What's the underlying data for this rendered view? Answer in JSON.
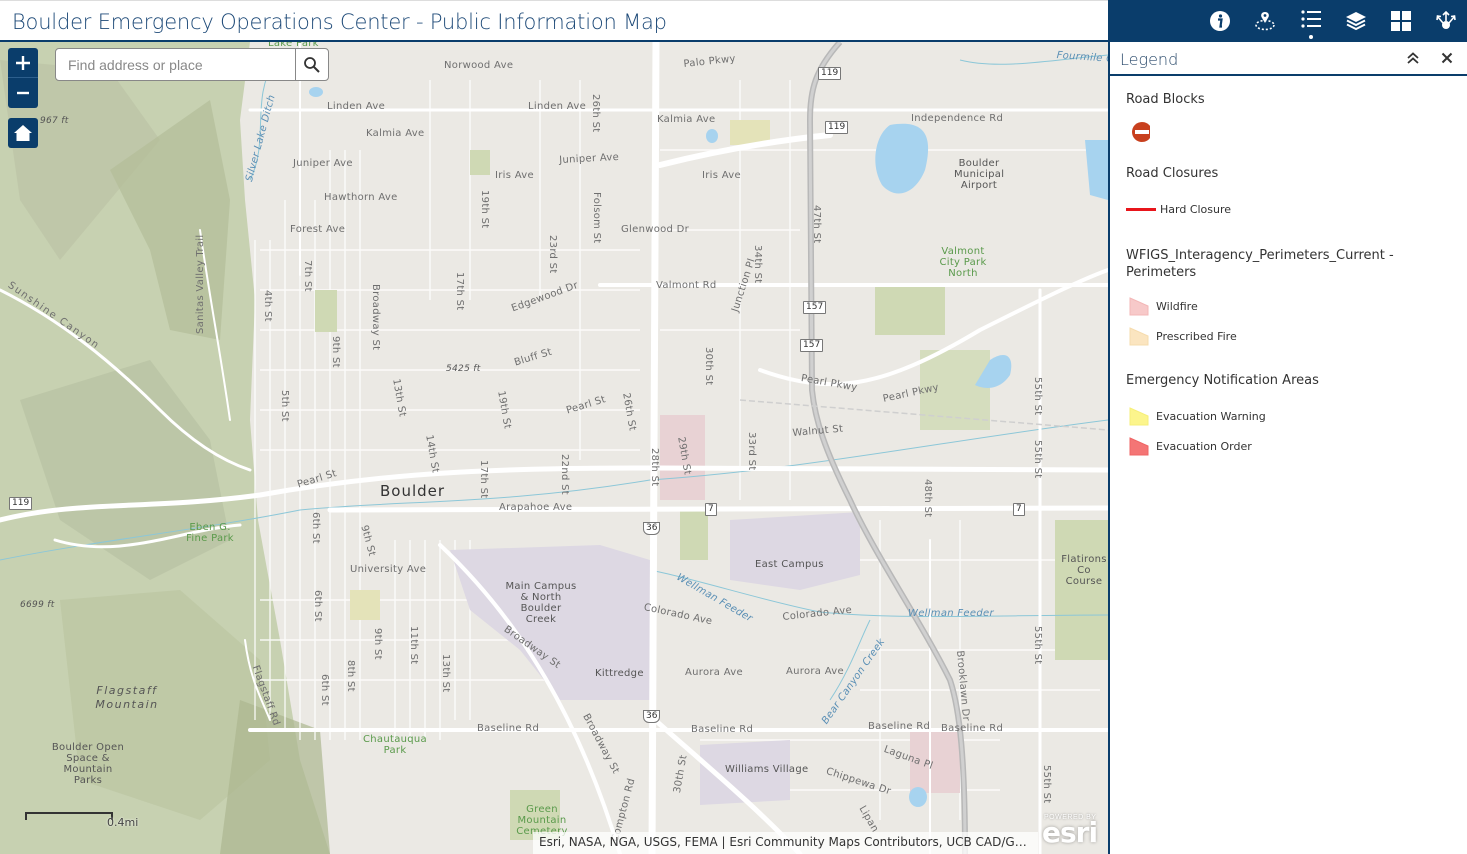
{
  "header": {
    "title": "Boulder Emergency Operations Center - Public Information Map"
  },
  "map": {
    "controls": {
      "zoom_in": "+",
      "zoom_out": "−",
      "home": "home"
    },
    "search": {
      "placeholder": "Find address or place",
      "value": ""
    },
    "scalebar": {
      "label": "0.4mi"
    },
    "attribution": "Esri, NASA, NGA, USGS, FEMA | Esri Community Maps Contributors, UCB CAD/G…",
    "esri_logo": {
      "powered_by": "POWERED BY",
      "brand": "esri"
    },
    "labels": {
      "lake_park": "Lake Park",
      "norwood_ave": "Norwood Ave",
      "palo_pkwy": "Palo Pkwy",
      "fourmile": "Fourmile Cr",
      "linden_ave_1": "Linden Ave",
      "linden_ave_2": "Linden Ave",
      "kalmia_ave_1": "Kalmia Ave",
      "kalmia_ave_2": "Kalmia Ave",
      "independence_rd": "Independence Rd",
      "juniper_ave_1": "Juniper Ave",
      "juniper_ave_2": "Juniper Ave",
      "iris_ave_1": "Iris Ave",
      "iris_ave_2": "Iris Ave",
      "hawthorn_ave": "Hawthorn Ave",
      "forest_ave": "Forest Ave",
      "glenwood_dr": "Glenwood Dr",
      "valmont_rd": "Valmont Rd",
      "edgewood_dr": "Edgewood Dr",
      "bluff_st": "Bluff St",
      "pearl_st_1": "Pearl St",
      "pearl_st_2": "Pearl St",
      "pearl_pkwy_1": "Pearl Pkwy",
      "pearl_pkwy_2": "Pearl Pkwy",
      "walnut_st": "Walnut St",
      "arapahoe_ave": "Arapahoe Ave",
      "university_ave": "University Ave",
      "colorado_ave_1": "Colorado Ave",
      "colorado_ave_2": "Colorado Ave",
      "aurora_ave_1": "Aurora Ave",
      "aurora_ave_2": "Aurora Ave",
      "baseline_rd_1": "Baseline Rd",
      "baseline_rd_2": "Baseline Rd",
      "baseline_rd_3": "Baseline Rd",
      "baseline_rd_4": "Baseline Rd",
      "broadway_st_1": "Broadway St",
      "broadway_st_2": "Broadway St",
      "broadway_st_3": "Broadway St",
      "st_4th": "4th St",
      "st_5th": "5th St",
      "st_6th_1": "6th St",
      "st_6th_2": "6th St",
      "st_6th_3": "6th St",
      "st_7th": "7th St",
      "st_8th": "8th St",
      "st_9th_1": "9th St",
      "st_9th_2": "9th St",
      "st_9th_3": "9th St",
      "st_11th": "11th St",
      "st_13th_1": "13th St",
      "st_13th_2": "13th St",
      "st_14th": "14th St",
      "st_17th_1": "17th St",
      "st_17th_2": "17th St",
      "st_19th_1": "19th St",
      "st_19th_2": "19th St",
      "st_22nd": "22nd St",
      "st_23rd": "23rd St",
      "st_26th_1": "26th St",
      "st_26th_2": "26th St",
      "folsom_st": "Folsom St",
      "st_28th": "28th St",
      "st_29th": "29th St",
      "st_30th_1": "30th St",
      "st_30th_2": "30th St",
      "st_33rd": "33rd St",
      "st_34th": "34th St",
      "junction_pl": "Junction Pl",
      "st_47th": "47th St",
      "st_48th": "48th St",
      "st_55th_1": "55th St",
      "st_55th_2": "55th St",
      "st_55th_3": "55th St",
      "st_55th_4": "55th St",
      "brooklawn_dr": "Brooklawn Dr",
      "laguna_pl": "Laguna Pl",
      "chippewa_dr": "Chippewa Dr",
      "lipan": "Lipan",
      "compton_rd": "Compton Rd",
      "flagstaff_rd": "Flagstaff Rd",
      "sunshine_canyon": "Sunshine Canyon",
      "sanitas_valley_trail": "Sanitas Valley Trail",
      "silver_lake_ditch": "Silver Lake Ditch",
      "wellman_feeder_1": "Wellman Feeder",
      "wellman_feeder_2": "Wellman Feeder",
      "bear_canyon_creek": "Bear Canyon Creek",
      "boulder": "Boulder",
      "airport": "Boulder Municipal Airport",
      "valmont_city_park": "Valmont City Park North",
      "eben_fine_park": "Eben G. Fine Park",
      "main_campus": "Main Campus & North Boulder Creek",
      "east_campus": "East Campus",
      "kittredge": "Kittredge",
      "williams_village": "Williams Village",
      "chautauqua_park": "Chautauqua Park",
      "green_mountain_cemetery": "Green Mountain Cemetery",
      "flatirons_course": "Flatirons Co Course",
      "flagstaff_mountain": "Flagstaff Mountain",
      "osmp": "Boulder Open Space & Mountain Parks",
      "elev_5425": "5425 ft",
      "elev_6699": "6699 ft",
      "elev_967": "967 ft"
    },
    "shields": {
      "hwy119_a": "119",
      "hwy119_b": "119",
      "hwy119_c": "119",
      "hwy157_a": "157",
      "hwy157_b": "157",
      "hwy7_a": "7",
      "hwy7_b": "7",
      "us36_a": "36",
      "us36_b": "36"
    }
  },
  "toolbar": {
    "icons": [
      "info-icon",
      "map-pin-icon",
      "legend-icon",
      "layers-icon",
      "basemap-gallery-icon",
      "share-icon"
    ],
    "active": "legend-icon"
  },
  "panel": {
    "title": "Legend",
    "collapse_label": "collapse",
    "close_label": "close",
    "groups": [
      {
        "title": "Road Blocks",
        "items": [
          {
            "label": "",
            "symbol": "no-entry",
            "color": "#c8401e"
          }
        ]
      },
      {
        "title": "Road Closures",
        "items": [
          {
            "label": "Hard Closure",
            "symbol": "line",
            "color": "#e8151b"
          }
        ]
      },
      {
        "title": "WFIGS_Interagency_Perimeters_Current - Perimeters",
        "items": [
          {
            "label": "Wildfire",
            "symbol": "polygon",
            "color": "#f7c9c9"
          },
          {
            "label": "Prescribed Fire",
            "symbol": "polygon",
            "color": "#fbe5c0"
          }
        ]
      },
      {
        "title": "Emergency Notification Areas",
        "items": [
          {
            "label": "Evacuation Warning",
            "symbol": "polygon",
            "color": "#fcf58c"
          },
          {
            "label": "Evacuation Order",
            "symbol": "polygon",
            "color": "#f47575"
          }
        ]
      }
    ]
  },
  "colors": {
    "brand": "#0a3d6b",
    "title_text": "#1e4a78"
  }
}
